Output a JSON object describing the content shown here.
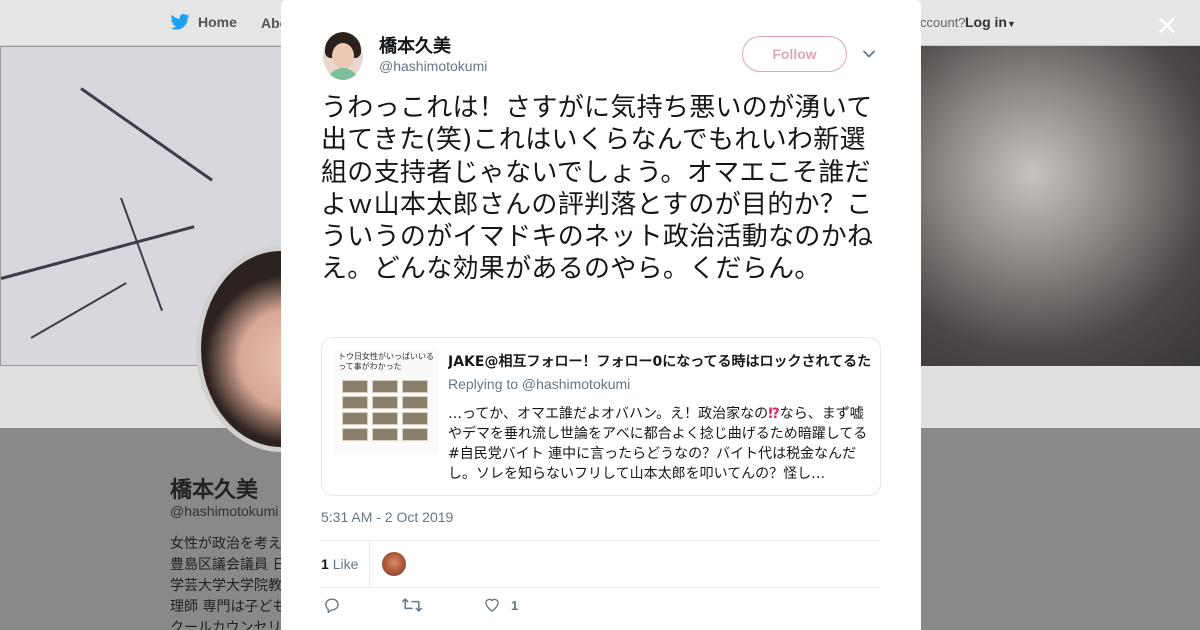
{
  "background": {
    "nav": {
      "home_label": "Home",
      "about_label": "Abo",
      "account_text": "ccount?",
      "login_label": "Log in"
    },
    "profile": {
      "name": "橋本久美",
      "handle": "@hashimotokumi",
      "bio_lines": [
        "女性が政治を考え",
        "豊島区議会議員 日",
        "学芸大学大学院教",
        "理師 専門は子ども",
        "クールカウンセリ"
      ]
    }
  },
  "modal": {
    "close_label": "×",
    "tweet": {
      "author_name": "橋本久美",
      "author_handle": "@hashimotokumi",
      "follow_label": "Follow",
      "text": "うわっこれは！さすがに気持ち悪いのが湧いて出てきた(笑)これはいくらなんでもれいわ新選組の支持者じゃないでしょう。オマエこそ誰だよｗ山本太郎さんの評判落とすのが目的か？こういうのがイマドキのネット政治活動なのかねえ。どんな効果があるのやら。くだらん。",
      "quoted": {
        "thumb_caption": "トウ日女性がいっぱいいるって事がわかった",
        "title": "JAKE@相互フォロー！フォロー0になってる時はロックされてるた",
        "replying_to": "Replying to @hashimotokumi",
        "body_before": "…ってか、オマエ誰だよオバハン。え！政治家なの",
        "body_emoji": "⁉",
        "body_after": "なら、まず嘘やデマを垂れ流し世論をアベに都合よく捻じ曲げるため暗躍してる #自民党バイト 連中に言ったらどうなの？バイト代は税金なんだし。ソレを知らないフリして山本太郎を叩いてんの？怪し…"
      },
      "timestamp": "5:31 AM - 2 Oct 2019",
      "like_count": "1",
      "like_label": "Like",
      "action_like_count": "1"
    }
  },
  "colors": {
    "follow_border": "#e0a6b3",
    "muted_text": "#657786",
    "twitter_blue": "#1da1f2"
  }
}
